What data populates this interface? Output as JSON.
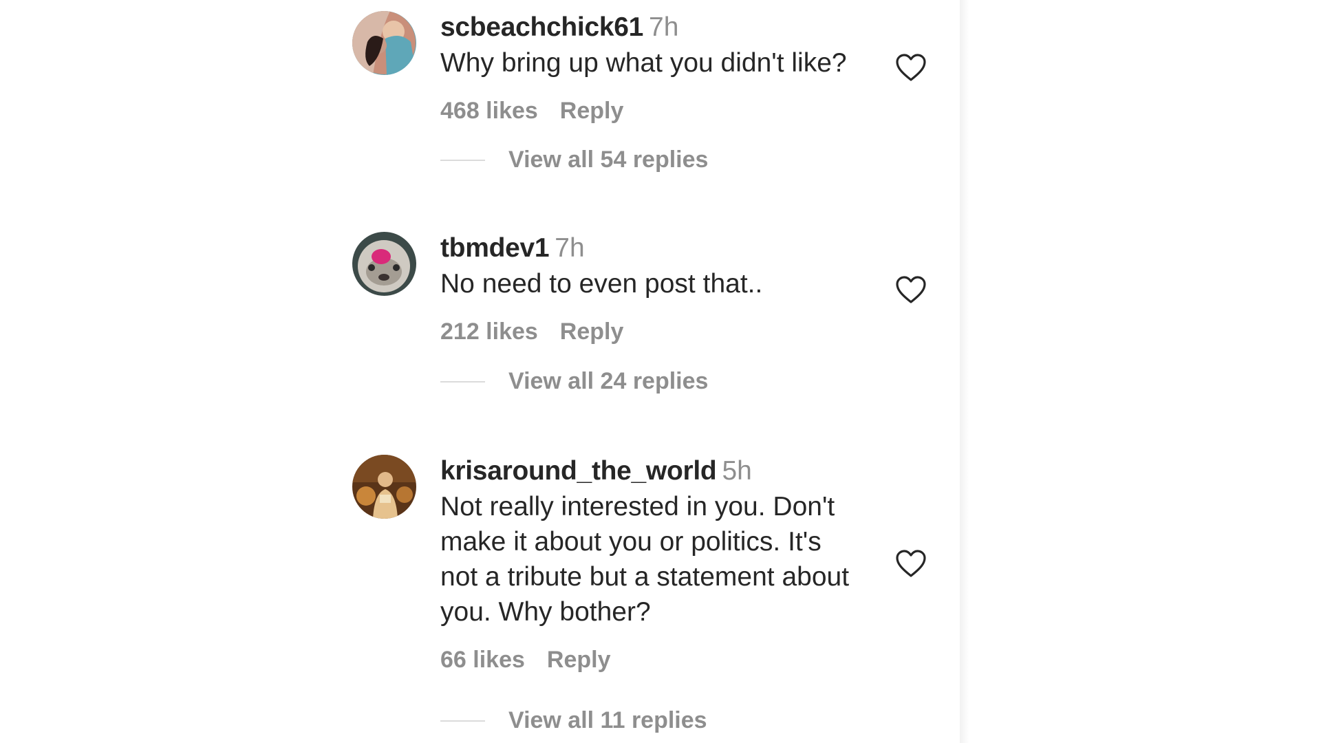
{
  "comments": [
    {
      "username": "scbeachchick61",
      "time": "7h",
      "text": "Why bring up what you didn't like?",
      "likes": "468 likes",
      "reply_label": "Reply",
      "view_replies": "View all 54 replies",
      "like_icon": "heart-outline-icon"
    },
    {
      "username": "tbmdev1",
      "time": "7h",
      "text": "No need to even post that..",
      "likes": "212 likes",
      "reply_label": "Reply",
      "view_replies": "View all 24 replies",
      "like_icon": "heart-outline-icon"
    },
    {
      "username": "krisaround_the_world",
      "time": "5h",
      "text": "Not really interested in you. Don't\nmake it about you or politics. It's\nnot a tribute but a statement about\nyou. Why bother?",
      "likes": "66 likes",
      "reply_label": "Reply",
      "view_replies": "View all 11 replies",
      "like_icon": "heart-outline-icon"
    }
  ],
  "colors": {
    "primary_text": "#262626",
    "secondary_text": "#8e8e8e",
    "divider": "#dbdbdb",
    "background": "#ffffff"
  }
}
